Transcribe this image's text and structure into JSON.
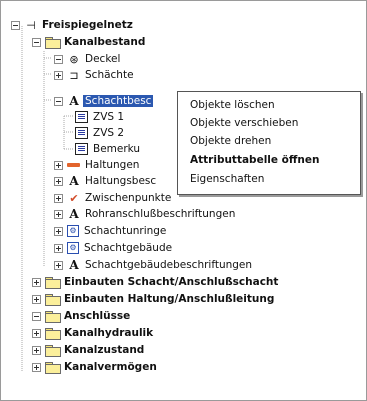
{
  "tree": {
    "root": "Freispiegelnetz",
    "kanalbestand": "Kanalbestand",
    "deckel": "Deckel",
    "schaechte": "Schächte",
    "schachtbeschriftung": "Schachtbesc",
    "zvs1": "ZVS 1",
    "zvs2": "ZVS 2",
    "bemerkung": "Bemerku",
    "haltungen": "Haltungen",
    "haltungsbeschriftung": "Haltungsbesc",
    "zwischenpunkte": "Zwischenpunkte",
    "rohranschluss": "Rohranschlußbeschriftungen",
    "schachtunringe": "Schachtunringe",
    "schachtgebaeude": "Schachtgebäude",
    "schachtgebaeudebeschriftungen": "Schachtgebäudebeschriftungen",
    "einbauten_schacht": "Einbauten Schacht/Anschlußschacht",
    "einbauten_haltung": "Einbauten Haltung/Anschlußleitung",
    "anschluesse": "Anschlüsse",
    "kanalhydraulik": "Kanalhydraulik",
    "kanalzustand": "Kanalzustand",
    "kanalvermoegen": "Kanalvermögen"
  },
  "context_menu": {
    "items": [
      "Objekte löschen",
      "Objekte verschieben",
      "Objekte drehen",
      "Attributtabelle öffnen",
      "Eigenschaften"
    ]
  },
  "colors": {
    "selection": "#2b58b0",
    "folder": "#fbef9b"
  }
}
